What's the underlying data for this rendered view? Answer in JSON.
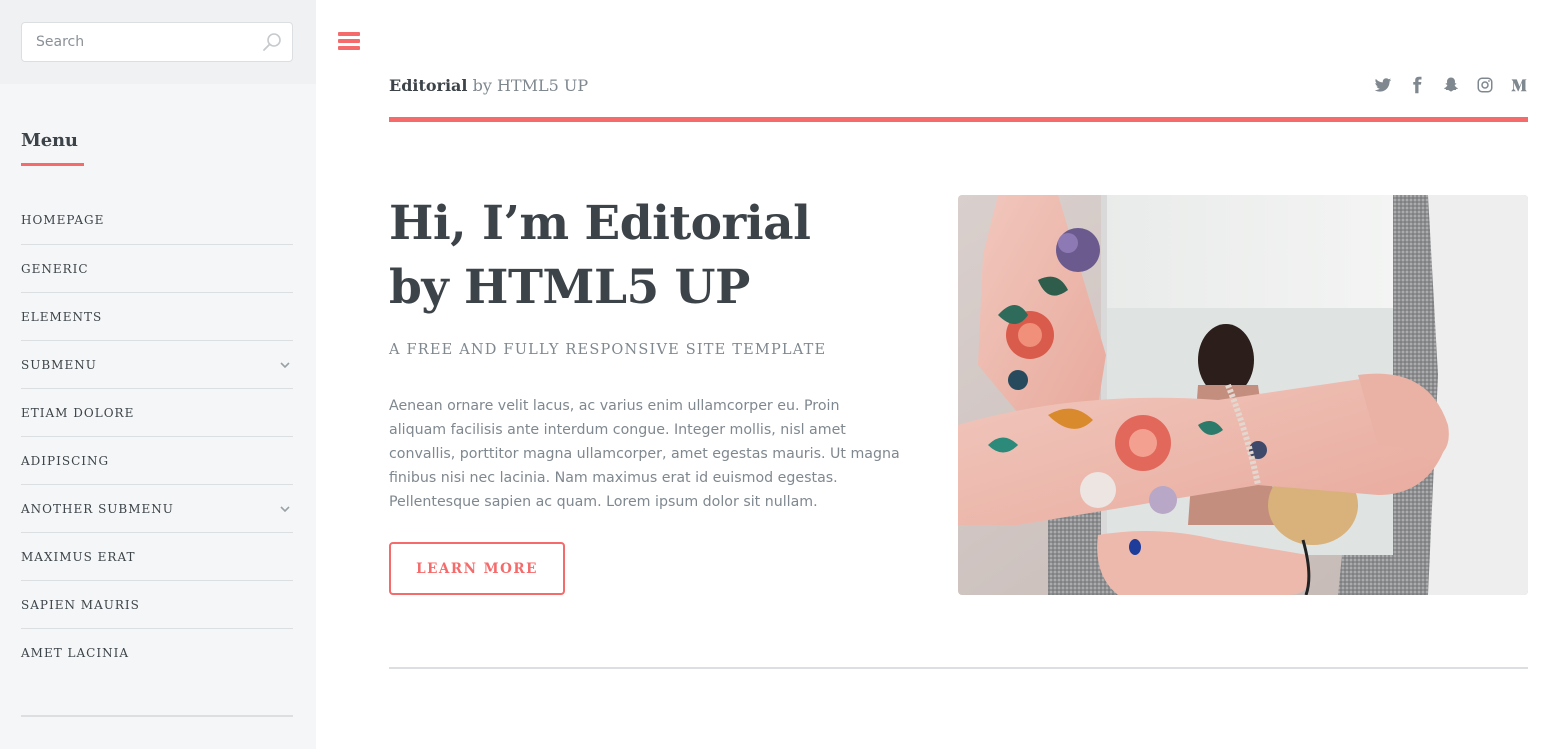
{
  "sidebar": {
    "search": {
      "placeholder": "Search"
    },
    "menu_title": "Menu",
    "items": [
      {
        "label": "HOMEPAGE",
        "has_submenu": false
      },
      {
        "label": "GENERIC",
        "has_submenu": false
      },
      {
        "label": "ELEMENTS",
        "has_submenu": false
      },
      {
        "label": "SUBMENU",
        "has_submenu": true
      },
      {
        "label": "ETIAM DOLORE",
        "has_submenu": false
      },
      {
        "label": "ADIPISCING",
        "has_submenu": false
      },
      {
        "label": "ANOTHER SUBMENU",
        "has_submenu": true
      },
      {
        "label": "MAXIMUS ERAT",
        "has_submenu": false
      },
      {
        "label": "SAPIEN MAURIS",
        "has_submenu": false
      },
      {
        "label": "AMET LACINIA",
        "has_submenu": false
      }
    ]
  },
  "header": {
    "logo_bold": "Editorial",
    "logo_rest": " by HTML5 UP",
    "social_icons": [
      "twitter-icon",
      "facebook-icon",
      "snapchat-icon",
      "instagram-icon",
      "medium-icon"
    ]
  },
  "hero": {
    "title_line1": "Hi, I’m Editorial",
    "title_line2": "by HTML5 UP",
    "subtitle": "A FREE AND FULLY RESPONSIVE SITE TEMPLATE",
    "body": "Aenean ornare velit lacus, ac varius enim ullamcorper eu. Proin aliquam facilisis ante interdum congue. Integer mollis, nisl amet convallis, porttitor magna ullamcorper, amet egestas mauris. Ut magna finibus nisi nec lacinia. Nam maximus erat id euismod egestas. Pellentesque sapien ac quam. Lorem ipsum dolor sit nullam.",
    "button_label": "LEARN MORE"
  },
  "colors": {
    "accent": "#f56a6a",
    "text": "#3d4449",
    "muted": "#7f888f",
    "sidebar_bg": "#f5f6f7"
  }
}
